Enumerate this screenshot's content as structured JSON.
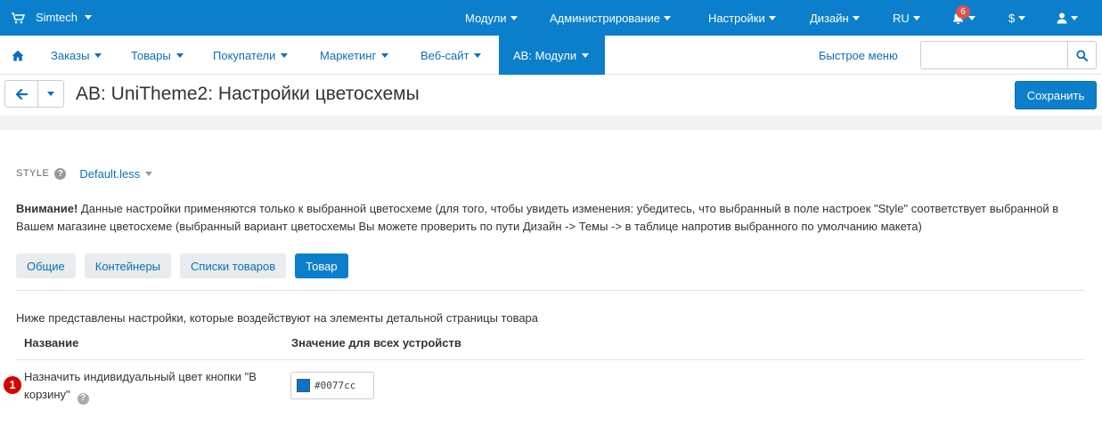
{
  "topbar": {
    "brand": "Simtech",
    "menu": [
      "Модули",
      "Администрирование",
      "Настройки",
      "Дизайн",
      "RU"
    ],
    "notifications_count": "6",
    "currency": "$",
    "cart_icon": "cart-icon",
    "bell_icon": "bell-icon",
    "user_icon": "user-icon"
  },
  "navbar": {
    "home_icon": "home-icon",
    "items": [
      "Заказы",
      "Товары",
      "Покупатели",
      "Маркетинг",
      "Веб-сайт",
      "AB: Модули"
    ],
    "active_item": "AB: Модули",
    "quick_menu": "Быстрое меню",
    "search_placeholder": "",
    "search_icon": "search-icon"
  },
  "titlebar": {
    "title": "AB: UniTheme2: Настройки цветосхемы",
    "save_label": "Сохранить"
  },
  "content": {
    "style_label": "STYLE",
    "style_value": "Default.less",
    "notice_bold": "Внимание!",
    "notice_text": " Данные настройки применяются только к выбранной цветосхеме (для того, чтобы увидеть изменения: убедитесь, что выбранный в поле настроек \"Style\" соответствует выбранной в Вашем магазине цветосхеме (выбранный вариант цветосхемы Вы можете проверить по пути Дизайн -> Темы -> в таблице напротив выбранного по умолчанию макета)",
    "tabs": [
      "Общие",
      "Контейнеры",
      "Списки товаров",
      "Товар"
    ],
    "active_tab": "Товар",
    "description": "Ниже представлены настройки, которые воздействуют на элементы детальной страницы товара",
    "col_name": "Название",
    "col_value": "Значение для всех устройств",
    "setting": {
      "marker": "1",
      "label": "Назначить индивидуальный цвет кнопки \"В корзину\"",
      "color_value": "#0077cc"
    }
  },
  "colors": {
    "accent": "#0b7fcc",
    "link": "#0b6fb8",
    "badge": "#d9534f",
    "marker": "#d60000",
    "swatch": "#0077cc"
  }
}
